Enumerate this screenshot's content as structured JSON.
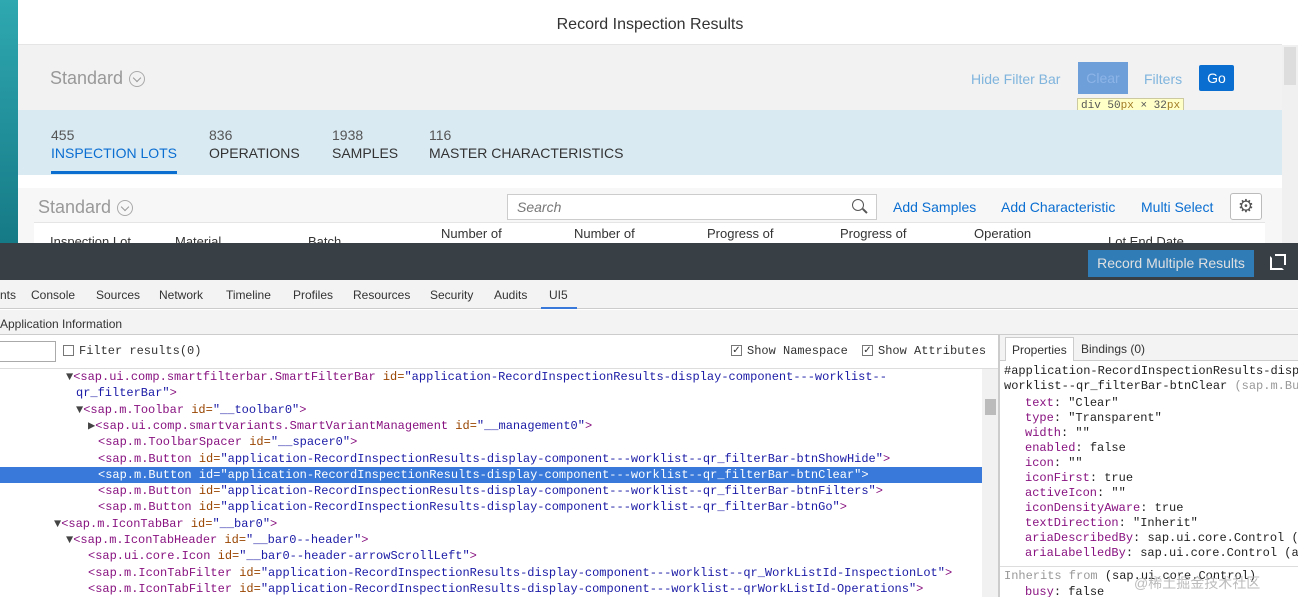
{
  "app": {
    "title": "Record Inspection Results",
    "variant": "Standard",
    "filterbar": {
      "hide_label": "Hide Filter Bar",
      "clear_label": "Clear",
      "filters_label": "Filters",
      "go_label": "Go"
    },
    "tooltip": {
      "tag": "div",
      "w": "50",
      "h": "32",
      "unit": "px",
      "times": "×"
    },
    "tabs": [
      {
        "count": "455",
        "label": "INSPECTION LOTS"
      },
      {
        "count": "836",
        "label": "OPERATIONS"
      },
      {
        "count": "1938",
        "label": "SAMPLES"
      },
      {
        "count": "116",
        "label": "MASTER CHARACTERISTICS"
      }
    ],
    "table_toolbar": {
      "variant": "Standard",
      "search_placeholder": "Search",
      "add_samples": "Add Samples",
      "add_characteristic": "Add Characteristic",
      "multi_select": "Multi Select"
    },
    "columns": [
      "Inspection Lot",
      "Material",
      "Batch",
      "Number of",
      "Number of",
      "Progress of",
      "Progress of",
      "Operation",
      "Lot End Date"
    ],
    "footer_button": "Record Multiple Results"
  },
  "devtools": {
    "tabs": [
      "nts",
      "Console",
      "Sources",
      "Network",
      "Timeline",
      "Profiles",
      "Resources",
      "Security",
      "Audits",
      "UI5"
    ],
    "section_title": "Application Information",
    "filter_results": "Filter results(0)",
    "show_namespace": "Show Namespace",
    "show_attributes": "Show Attributes",
    "tree": [
      {
        "tri": "▼",
        "tag": "<sap.ui.comp.smartfilterbar.SmartFilterBar",
        "an": " id=",
        "av": "\"application-RecordInspectionResults-display-component---worklist--",
        "end": ""
      },
      {
        "tri": "",
        "tag": "",
        "an": "",
        "av": "qr_filterBar\"",
        "end": ">"
      },
      {
        "tri": "▼",
        "tag": "<sap.m.Toolbar",
        "an": " id=",
        "av": "\"__toolbar0\"",
        "end": ">"
      },
      {
        "tri": "▶",
        "tag": "<sap.ui.comp.smartvariants.SmartVariantManagement",
        "an": " id=",
        "av": "\"__management0\"",
        "end": ">"
      },
      {
        "tri": "",
        "tag": "<sap.m.ToolbarSpacer",
        "an": " id=",
        "av": "\"__spacer0\"",
        "end": ">"
      },
      {
        "tri": "",
        "tag": "<sap.m.Button",
        "an": " id=",
        "av": "\"application-RecordInspectionResults-display-component---worklist--qr_filterBar-btnShowHide\"",
        "end": ">"
      },
      {
        "tri": "",
        "tag": "<sap.m.Button",
        "an": " id=",
        "av": "\"application-RecordInspectionResults-display-component---worklist--qr_filterBar-btnClear\"",
        "end": ">"
      },
      {
        "tri": "",
        "tag": "<sap.m.Button",
        "an": " id=",
        "av": "\"application-RecordInspectionResults-display-component---worklist--qr_filterBar-btnFilters\"",
        "end": ">"
      },
      {
        "tri": "",
        "tag": "<sap.m.Button",
        "an": " id=",
        "av": "\"application-RecordInspectionResults-display-component---worklist--qr_filterBar-btnGo\"",
        "end": ">"
      },
      {
        "tri": "▼",
        "tag": "<sap.m.IconTabBar",
        "an": " id=",
        "av": "\"__bar0\"",
        "end": ">"
      },
      {
        "tri": "▼",
        "tag": "<sap.m.IconTabHeader",
        "an": " id=",
        "av": "\"__bar0--header\"",
        "end": ">"
      },
      {
        "tri": "",
        "tag": "<sap.ui.core.Icon",
        "an": " id=",
        "av": "\"__bar0--header-arrowScrollLeft\"",
        "end": ">"
      },
      {
        "tri": "",
        "tag": "<sap.m.IconTabFilter",
        "an": " id=",
        "av": "\"application-RecordInspectionResults-display-component---worklist--qr_WorkListId-InspectionLot\"",
        "end": ">"
      },
      {
        "tri": "",
        "tag": "<sap.m.IconTabFilter",
        "an": " id=",
        "av": "\"application-RecordInspectionResults-display-component---worklist--qrWorkListId-Operations\"",
        "end": ">"
      }
    ],
    "right_tabs": [
      "Properties",
      "Bindings (0)"
    ],
    "selector": "#application-RecordInspectionResults-disp",
    "selector2": "worklist--qr_filterBar-btnClear",
    "selector2_type": "(sap.m.Bu",
    "props": [
      {
        "k": "text",
        "v": "\"Clear\""
      },
      {
        "k": "type",
        "v": "\"Transparent\""
      },
      {
        "k": "width",
        "v": "\"\""
      },
      {
        "k": "enabled",
        "v": "false"
      },
      {
        "k": "icon",
        "v": "\"\""
      },
      {
        "k": "iconFirst",
        "v": "true"
      },
      {
        "k": "activeIcon",
        "v": "\"\""
      },
      {
        "k": "iconDensityAware",
        "v": "true"
      },
      {
        "k": "textDirection",
        "v": "\"Inherit\""
      },
      {
        "k": "ariaDescribedBy",
        "v": "sap.ui.core.Control ("
      },
      {
        "k": "ariaLabelledBy",
        "v": "sap.ui.core.Control (a"
      }
    ],
    "inherits_label": "Inherits from",
    "inherits_value": "(sap.ui.core.Control)",
    "busy": {
      "k": "busy",
      "v": "false"
    },
    "watermark": "@稀土掘金技术社区"
  }
}
